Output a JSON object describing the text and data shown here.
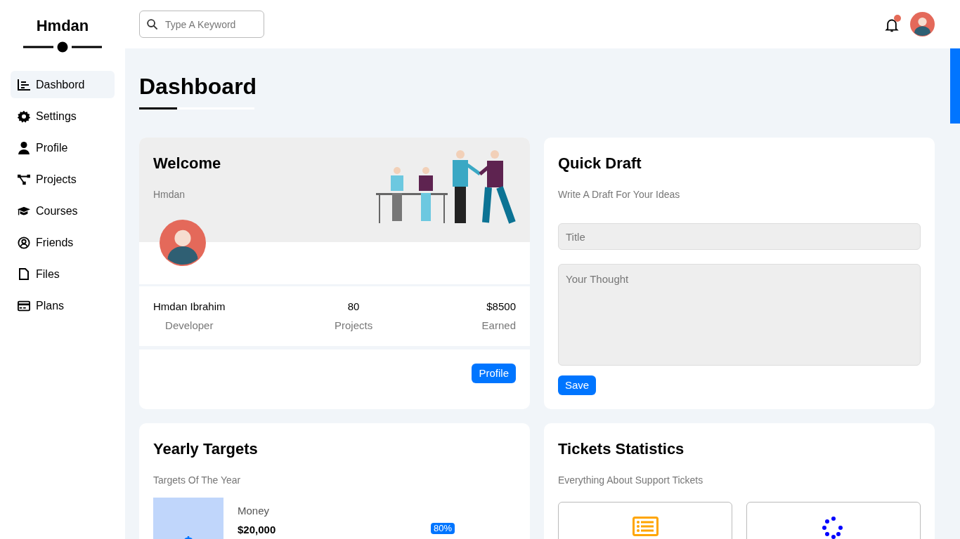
{
  "brand": "Hmdan",
  "sidebar": {
    "items": [
      {
        "label": "Dashbord",
        "selected": true
      },
      {
        "label": "Settings",
        "selected": false
      },
      {
        "label": "Profile",
        "selected": false
      },
      {
        "label": "Projects",
        "selected": false
      },
      {
        "label": "Courses",
        "selected": false
      },
      {
        "label": "Friends",
        "selected": false
      },
      {
        "label": "Files",
        "selected": false
      },
      {
        "label": "Plans",
        "selected": false
      }
    ]
  },
  "search": {
    "placeholder": "Type A Keyword"
  },
  "notifications": {
    "unread": true
  },
  "page_title": "Dashboard",
  "welcome": {
    "title": "Welcome",
    "subtitle": "Hmdan",
    "stats": [
      {
        "value": "Hmdan Ibrahim",
        "label": "Developer"
      },
      {
        "value": "80",
        "label": "Projects"
      },
      {
        "value": "$8500",
        "label": "Earned"
      }
    ],
    "button": "Profile"
  },
  "quick_draft": {
    "title": "Quick Draft",
    "subtitle": "Write A Draft For Your Ideas",
    "title_placeholder": "Title",
    "body_placeholder": "Your Thought",
    "button": "Save"
  },
  "yearly_targets": {
    "title": "Yearly Targets",
    "subtitle": "Targets Of The Year",
    "targets": [
      {
        "name": "Money",
        "amount": "$20,000",
        "percent": "80%"
      }
    ]
  },
  "tickets": {
    "title": "Tickets Statistics",
    "subtitle": "Everything About Support Tickets"
  }
}
